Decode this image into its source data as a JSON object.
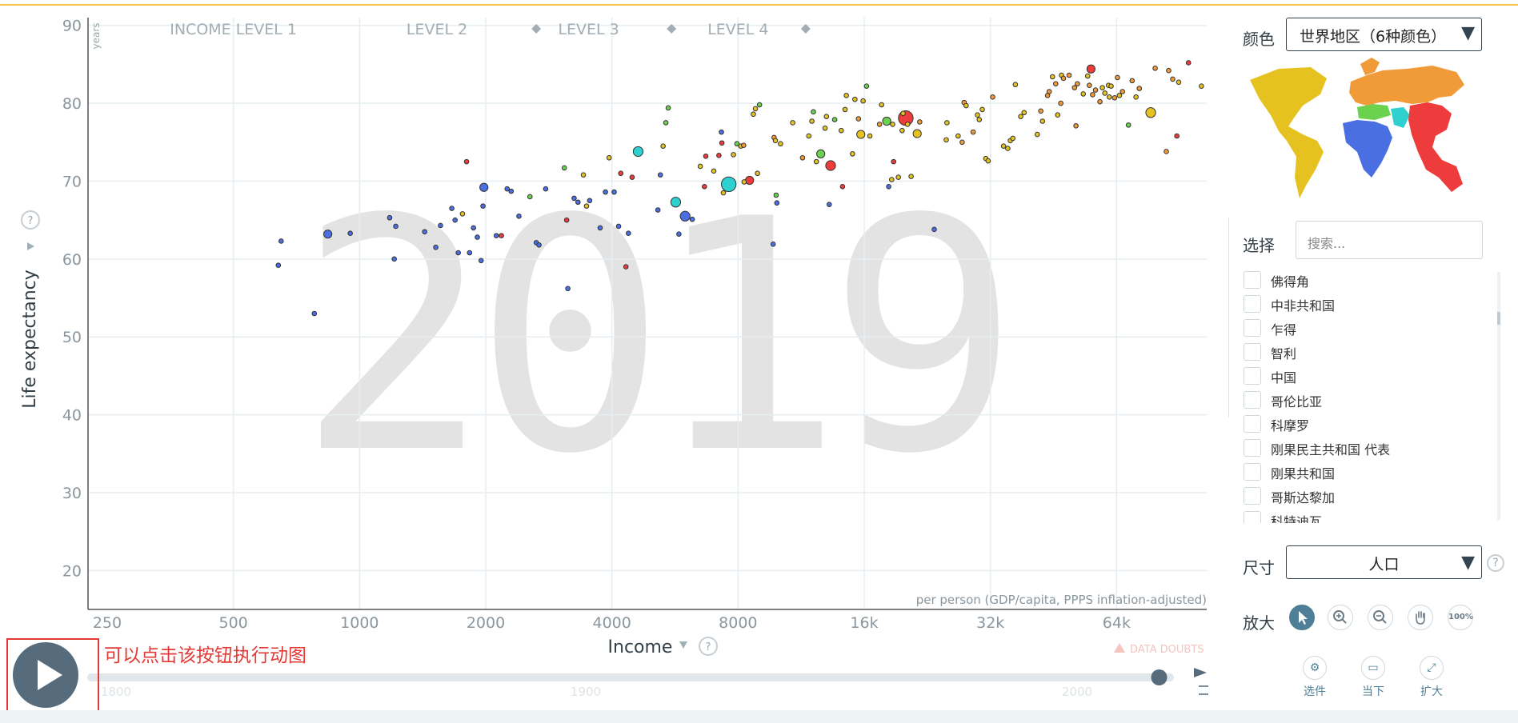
{
  "chart_data": {
    "type": "scatter",
    "year_watermark": "2019",
    "x_label": "Income",
    "x_caption": "per person (GDP/capita, PPPS inflation-adjusted)",
    "y_label": "Life expectancy",
    "y_unit": "years",
    "x_scale": "log",
    "x_ticks": [
      "250",
      "500",
      "1000",
      "2000",
      "4000",
      "8000",
      "16k",
      "32k",
      "64k"
    ],
    "y_ticks": [
      "90",
      "80",
      "70",
      "60",
      "50",
      "40",
      "30",
      "20"
    ],
    "xlim": [
      225,
      105000
    ],
    "ylim": [
      15,
      91
    ],
    "income_levels": [
      "INCOME LEVEL 1",
      "LEVEL 2",
      "LEVEL 3",
      "LEVEL 4"
    ],
    "data_doubts": "DATA DOUBTS",
    "region_colors": {
      "americas": "#e6c220",
      "europe": "#f09a38",
      "africa": "#4a6fe3",
      "asia": "#ee3b3b",
      "mideast": "#2fd0d0",
      "central": "#6ad24f"
    },
    "points": [
      {
        "x": 640,
        "y": 59.2,
        "c": "africa"
      },
      {
        "x": 650,
        "y": 62.3,
        "c": "africa"
      },
      {
        "x": 780,
        "y": 53,
        "c": "africa"
      },
      {
        "x": 840,
        "y": 63.2,
        "c": "africa",
        "s": 2
      },
      {
        "x": 950,
        "y": 63.3,
        "c": "africa"
      },
      {
        "x": 1180,
        "y": 65.3,
        "c": "africa"
      },
      {
        "x": 1220,
        "y": 64.2,
        "c": "africa"
      },
      {
        "x": 1210,
        "y": 60,
        "c": "africa"
      },
      {
        "x": 1430,
        "y": 63.5,
        "c": "africa"
      },
      {
        "x": 1520,
        "y": 61.5,
        "c": "africa"
      },
      {
        "x": 1560,
        "y": 64.3,
        "c": "africa"
      },
      {
        "x": 1660,
        "y": 66.5,
        "c": "africa"
      },
      {
        "x": 1690,
        "y": 65,
        "c": "africa"
      },
      {
        "x": 1720,
        "y": 60.8,
        "c": "africa"
      },
      {
        "x": 1760,
        "y": 65.8,
        "c": "americas"
      },
      {
        "x": 1800,
        "y": 72.5,
        "c": "asia"
      },
      {
        "x": 1830,
        "y": 60.8,
        "c": "africa"
      },
      {
        "x": 1870,
        "y": 64,
        "c": "africa"
      },
      {
        "x": 1910,
        "y": 62.8,
        "c": "africa"
      },
      {
        "x": 1950,
        "y": 59.8,
        "c": "africa"
      },
      {
        "x": 1980,
        "y": 69.2,
        "c": "africa",
        "s": 2
      },
      {
        "x": 1970,
        "y": 66.8,
        "c": "africa"
      },
      {
        "x": 2120,
        "y": 63,
        "c": "africa"
      },
      {
        "x": 2180,
        "y": 63,
        "c": "asia"
      },
      {
        "x": 2250,
        "y": 69,
        "c": "africa"
      },
      {
        "x": 2300,
        "y": 68.7,
        "c": "africa"
      },
      {
        "x": 2400,
        "y": 65.5,
        "c": "africa"
      },
      {
        "x": 2550,
        "y": 68,
        "c": "central"
      },
      {
        "x": 2640,
        "y": 62.1,
        "c": "africa"
      },
      {
        "x": 2680,
        "y": 61.8,
        "c": "africa"
      },
      {
        "x": 2780,
        "y": 69,
        "c": "africa"
      },
      {
        "x": 3080,
        "y": 71.7,
        "c": "central"
      },
      {
        "x": 3120,
        "y": 65,
        "c": "asia"
      },
      {
        "x": 3140,
        "y": 56.2,
        "c": "africa"
      },
      {
        "x": 3250,
        "y": 67.8,
        "c": "africa"
      },
      {
        "x": 3320,
        "y": 67.3,
        "c": "africa"
      },
      {
        "x": 3420,
        "y": 70.8,
        "c": "americas"
      },
      {
        "x": 3480,
        "y": 66.8,
        "c": "americas"
      },
      {
        "x": 3540,
        "y": 67.5,
        "c": "africa"
      },
      {
        "x": 3750,
        "y": 64,
        "c": "africa"
      },
      {
        "x": 3860,
        "y": 68.6,
        "c": "africa"
      },
      {
        "x": 3940,
        "y": 73,
        "c": "americas"
      },
      {
        "x": 4050,
        "y": 68.6,
        "c": "africa"
      },
      {
        "x": 4150,
        "y": 64.2,
        "c": "africa"
      },
      {
        "x": 4200,
        "y": 71,
        "c": "asia"
      },
      {
        "x": 4320,
        "y": 59,
        "c": "asia"
      },
      {
        "x": 4380,
        "y": 63.3,
        "c": "africa"
      },
      {
        "x": 4470,
        "y": 70.5,
        "c": "asia"
      },
      {
        "x": 4620,
        "y": 73.8,
        "c": "mideast",
        "s": 3
      },
      {
        "x": 5150,
        "y": 66.3,
        "c": "africa"
      },
      {
        "x": 5220,
        "y": 70.8,
        "c": "africa"
      },
      {
        "x": 5300,
        "y": 74.5,
        "c": "americas"
      },
      {
        "x": 5380,
        "y": 77.5,
        "c": "central"
      },
      {
        "x": 5450,
        "y": 79.4,
        "c": "central"
      },
      {
        "x": 5680,
        "y": 67.3,
        "c": "mideast",
        "s": 3
      },
      {
        "x": 5780,
        "y": 63.2,
        "c": "africa"
      },
      {
        "x": 5980,
        "y": 65.5,
        "c": "africa",
        "s": 3
      },
      {
        "x": 6220,
        "y": 65.1,
        "c": "africa"
      },
      {
        "x": 6500,
        "y": 71.9,
        "c": "americas"
      },
      {
        "x": 6650,
        "y": 69.3,
        "c": "asia"
      },
      {
        "x": 6700,
        "y": 73.2,
        "c": "asia"
      },
      {
        "x": 7000,
        "y": 71.3,
        "c": "americas"
      },
      {
        "x": 7200,
        "y": 73.3,
        "c": "asia"
      },
      {
        "x": 7300,
        "y": 76.3,
        "c": "africa"
      },
      {
        "x": 7320,
        "y": 74.9,
        "c": "asia"
      },
      {
        "x": 7380,
        "y": 68.5,
        "c": "americas"
      },
      {
        "x": 7600,
        "y": 69.6,
        "c": "mideast",
        "s": 7
      },
      {
        "x": 7800,
        "y": 73.4,
        "c": "americas"
      },
      {
        "x": 7950,
        "y": 74.8,
        "c": "central"
      },
      {
        "x": 8120,
        "y": 74.5,
        "c": "americas"
      },
      {
        "x": 8250,
        "y": 74.6,
        "c": "europe"
      },
      {
        "x": 8270,
        "y": 69.9,
        "c": "americas"
      },
      {
        "x": 8520,
        "y": 70.1,
        "c": "asia",
        "s": 2
      },
      {
        "x": 8700,
        "y": 78.6,
        "c": "americas"
      },
      {
        "x": 8800,
        "y": 79.3,
        "c": "americas"
      },
      {
        "x": 8900,
        "y": 71,
        "c": "americas"
      },
      {
        "x": 9000,
        "y": 79.8,
        "c": "central"
      },
      {
        "x": 9700,
        "y": 61.9,
        "c": "africa"
      },
      {
        "x": 9750,
        "y": 75.6,
        "c": "europe"
      },
      {
        "x": 9820,
        "y": 75.2,
        "c": "americas"
      },
      {
        "x": 9860,
        "y": 68.2,
        "c": "central"
      },
      {
        "x": 9900,
        "y": 67.2,
        "c": "africa"
      },
      {
        "x": 10100,
        "y": 74.8,
        "c": "americas"
      },
      {
        "x": 10800,
        "y": 77.5,
        "c": "americas"
      },
      {
        "x": 11400,
        "y": 73,
        "c": "europe"
      },
      {
        "x": 11800,
        "y": 75.8,
        "c": "americas"
      },
      {
        "x": 12000,
        "y": 77.7,
        "c": "americas"
      },
      {
        "x": 12100,
        "y": 78.9,
        "c": "central"
      },
      {
        "x": 12300,
        "y": 72.5,
        "c": "americas"
      },
      {
        "x": 12600,
        "y": 73.5,
        "c": "central",
        "s": 2
      },
      {
        "x": 12900,
        "y": 76.8,
        "c": "americas"
      },
      {
        "x": 13000,
        "y": 78.3,
        "c": "americas"
      },
      {
        "x": 13200,
        "y": 67,
        "c": "africa"
      },
      {
        "x": 13300,
        "y": 72,
        "c": "asia",
        "s": 3
      },
      {
        "x": 13600,
        "y": 77.9,
        "c": "central"
      },
      {
        "x": 14100,
        "y": 76.5,
        "c": "americas"
      },
      {
        "x": 14200,
        "y": 69.3,
        "c": "asia"
      },
      {
        "x": 14400,
        "y": 79.2,
        "c": "americas"
      },
      {
        "x": 14500,
        "y": 81,
        "c": "americas"
      },
      {
        "x": 15000,
        "y": 73.5,
        "c": "americas"
      },
      {
        "x": 15200,
        "y": 80.5,
        "c": "americas"
      },
      {
        "x": 15500,
        "y": 78,
        "c": "europe"
      },
      {
        "x": 15700,
        "y": 76,
        "c": "americas",
        "s": 2
      },
      {
        "x": 15900,
        "y": 80.3,
        "c": "americas"
      },
      {
        "x": 16200,
        "y": 82.2,
        "c": "central"
      },
      {
        "x": 16500,
        "y": 75.8,
        "c": "americas"
      },
      {
        "x": 17400,
        "y": 77.3,
        "c": "europe"
      },
      {
        "x": 17600,
        "y": 79.8,
        "c": "americas"
      },
      {
        "x": 18100,
        "y": 77.7,
        "c": "central",
        "s": 2
      },
      {
        "x": 18300,
        "y": 69.3,
        "c": "africa"
      },
      {
        "x": 18600,
        "y": 70.2,
        "c": "americas"
      },
      {
        "x": 18700,
        "y": 77.3,
        "c": "americas"
      },
      {
        "x": 18800,
        "y": 72.5,
        "c": "asia"
      },
      {
        "x": 19300,
        "y": 70.5,
        "c": "americas"
      },
      {
        "x": 19700,
        "y": 76.5,
        "c": "americas"
      },
      {
        "x": 19800,
        "y": 78.7,
        "c": "americas"
      },
      {
        "x": 20100,
        "y": 78.1,
        "c": "asia",
        "s": 7
      },
      {
        "x": 20300,
        "y": 77.3,
        "c": "americas"
      },
      {
        "x": 20700,
        "y": 70.6,
        "c": "americas"
      },
      {
        "x": 21400,
        "y": 76.1,
        "c": "americas",
        "s": 2
      },
      {
        "x": 21700,
        "y": 77.6,
        "c": "europe"
      },
      {
        "x": 23500,
        "y": 63.8,
        "c": "africa"
      },
      {
        "x": 25100,
        "y": 75.3,
        "c": "americas"
      },
      {
        "x": 25200,
        "y": 77.5,
        "c": "americas"
      },
      {
        "x": 26800,
        "y": 75.8,
        "c": "americas"
      },
      {
        "x": 27400,
        "y": 75,
        "c": "europe"
      },
      {
        "x": 27700,
        "y": 80.1,
        "c": "europe"
      },
      {
        "x": 28000,
        "y": 79.7,
        "c": "americas"
      },
      {
        "x": 29100,
        "y": 76.3,
        "c": "europe"
      },
      {
        "x": 29800,
        "y": 78.5,
        "c": "americas"
      },
      {
        "x": 30100,
        "y": 77.9,
        "c": "americas"
      },
      {
        "x": 30600,
        "y": 79.2,
        "c": "americas"
      },
      {
        "x": 31200,
        "y": 72.9,
        "c": "americas"
      },
      {
        "x": 31600,
        "y": 72.6,
        "c": "americas"
      },
      {
        "x": 32400,
        "y": 80.8,
        "c": "europe"
      },
      {
        "x": 34400,
        "y": 74.5,
        "c": "americas"
      },
      {
        "x": 35200,
        "y": 74.2,
        "c": "americas"
      },
      {
        "x": 35700,
        "y": 75.2,
        "c": "americas"
      },
      {
        "x": 36200,
        "y": 75.5,
        "c": "americas"
      },
      {
        "x": 36700,
        "y": 82.4,
        "c": "americas"
      },
      {
        "x": 37800,
        "y": 78.3,
        "c": "americas"
      },
      {
        "x": 38500,
        "y": 78.8,
        "c": "americas"
      },
      {
        "x": 41400,
        "y": 76,
        "c": "americas"
      },
      {
        "x": 42200,
        "y": 79,
        "c": "europe"
      },
      {
        "x": 42600,
        "y": 77.7,
        "c": "americas"
      },
      {
        "x": 43800,
        "y": 81,
        "c": "europe"
      },
      {
        "x": 44200,
        "y": 81.5,
        "c": "europe"
      },
      {
        "x": 45000,
        "y": 83.4,
        "c": "americas"
      },
      {
        "x": 45800,
        "y": 82.5,
        "c": "europe"
      },
      {
        "x": 46300,
        "y": 78.5,
        "c": "americas"
      },
      {
        "x": 47100,
        "y": 80,
        "c": "europe"
      },
      {
        "x": 47300,
        "y": 83.6,
        "c": "americas"
      },
      {
        "x": 47800,
        "y": 83.2,
        "c": "europe"
      },
      {
        "x": 49300,
        "y": 83.6,
        "c": "europe"
      },
      {
        "x": 50800,
        "y": 82,
        "c": "europe"
      },
      {
        "x": 51200,
        "y": 77.1,
        "c": "europe"
      },
      {
        "x": 51600,
        "y": 82.5,
        "c": "europe"
      },
      {
        "x": 53300,
        "y": 81.2,
        "c": "americas"
      },
      {
        "x": 54600,
        "y": 83.5,
        "c": "americas"
      },
      {
        "x": 55100,
        "y": 82.3,
        "c": "europe"
      },
      {
        "x": 55600,
        "y": 84.4,
        "c": "asia",
        "s": 2
      },
      {
        "x": 56100,
        "y": 81.1,
        "c": "europe"
      },
      {
        "x": 57000,
        "y": 81.7,
        "c": "europe"
      },
      {
        "x": 58400,
        "y": 80.2,
        "c": "europe"
      },
      {
        "x": 59200,
        "y": 82,
        "c": "americas"
      },
      {
        "x": 60000,
        "y": 81.3,
        "c": "americas"
      },
      {
        "x": 61200,
        "y": 82.3,
        "c": "americas"
      },
      {
        "x": 61500,
        "y": 80.8,
        "c": "americas"
      },
      {
        "x": 62100,
        "y": 82.2,
        "c": "americas"
      },
      {
        "x": 63300,
        "y": 80.7,
        "c": "europe"
      },
      {
        "x": 64300,
        "y": 83.3,
        "c": "europe"
      },
      {
        "x": 65000,
        "y": 81,
        "c": "americas"
      },
      {
        "x": 66100,
        "y": 81.5,
        "c": "europe"
      },
      {
        "x": 68300,
        "y": 77.2,
        "c": "central"
      },
      {
        "x": 69700,
        "y": 82.9,
        "c": "europe"
      },
      {
        "x": 71200,
        "y": 80.8,
        "c": "americas"
      },
      {
        "x": 72500,
        "y": 81.9,
        "c": "europe"
      },
      {
        "x": 77200,
        "y": 78.8,
        "c": "americas",
        "s": 3
      },
      {
        "x": 79100,
        "y": 84.5,
        "c": "europe"
      },
      {
        "x": 84100,
        "y": 73.8,
        "c": "europe"
      },
      {
        "x": 85200,
        "y": 84.2,
        "c": "europe"
      },
      {
        "x": 87100,
        "y": 83.1,
        "c": "europe"
      },
      {
        "x": 89100,
        "y": 75.8,
        "c": "asia"
      },
      {
        "x": 90000,
        "y": 82.7,
        "c": "americas"
      },
      {
        "x": 95000,
        "y": 85.2,
        "c": "asia"
      },
      {
        "x": 102000,
        "y": 82.2,
        "c": "americas"
      }
    ]
  },
  "timeline": {
    "start_label": "1800",
    "mid_label": "1900",
    "end_label": "2000",
    "position": 0.99
  },
  "play_note": "可以点击该按钮执行动图",
  "panel": {
    "color_label": "颜色",
    "color_value": "世界地区（6种颜色）",
    "select_label": "选择",
    "search_placeholder": "搜索...",
    "countries": [
      "佛得角",
      "中非共和国",
      "乍得",
      "智利",
      "中国",
      "哥伦比亚",
      "科摩罗",
      "刚果民主共和国 代表",
      "刚果共和国",
      "哥斯达黎加",
      "科特迪瓦"
    ],
    "size_label": "尺寸",
    "size_value": "人口",
    "zoom_label": "放大",
    "zoom_100": "100%",
    "tools": [
      {
        "label": "选件",
        "icon": "gear-icon"
      },
      {
        "label": "当下",
        "icon": "presentation-icon"
      },
      {
        "label": "扩大",
        "icon": "expand-icon"
      }
    ]
  }
}
